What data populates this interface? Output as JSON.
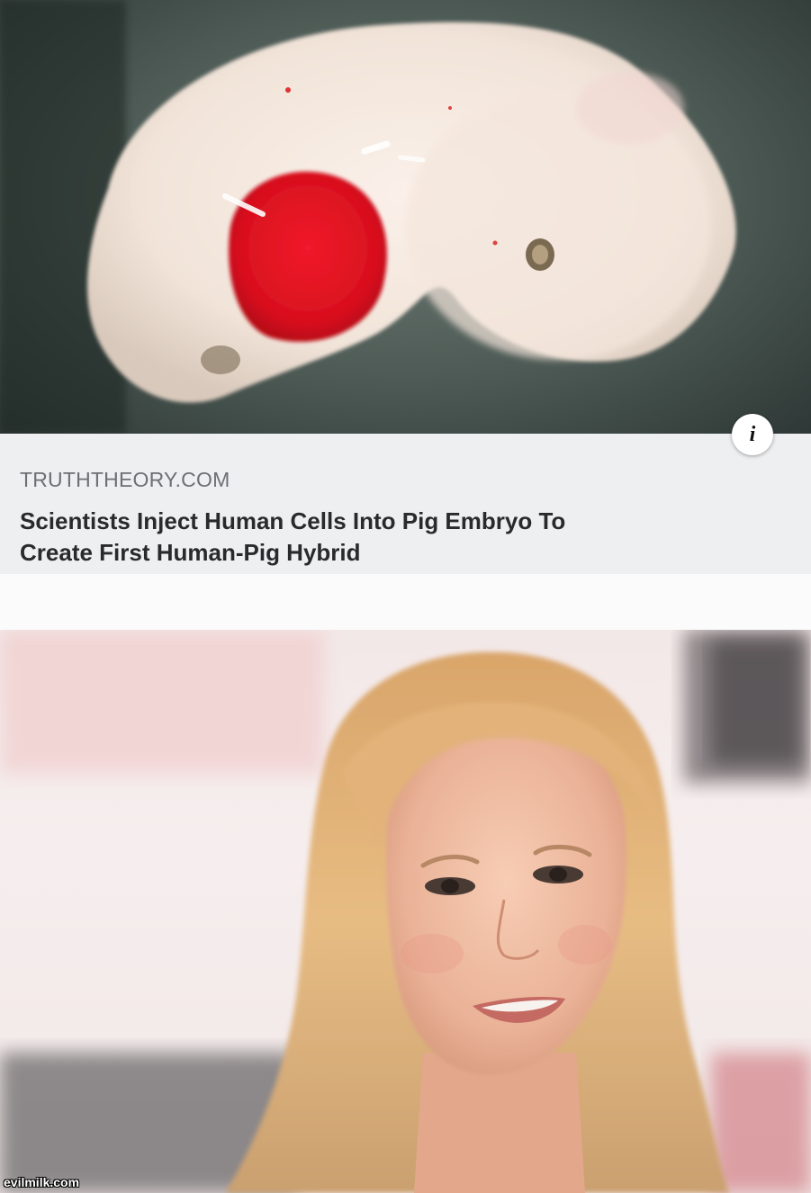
{
  "article": {
    "source": "TRUTHTHEORY.COM",
    "headline_line1": "Scientists Inject Human Cells Into Pig Embryo To",
    "headline_line2": "Create First Human-Pig Hybrid",
    "info_icon": "info-icon",
    "info_glyph": "i"
  },
  "photos": {
    "top": "embryo-photo",
    "bottom": "portrait-photo"
  },
  "watermark": "evilmilk.com",
  "colors": {
    "card_background": "#eeeff1",
    "source_text": "#6e6f73",
    "headline_text": "#2a2a2c"
  }
}
